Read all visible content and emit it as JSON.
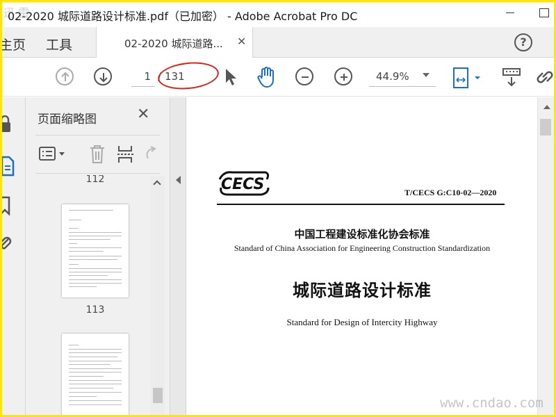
{
  "window": {
    "title": "02-2020 城际道路设计标准.pdf（已加密） - Adobe Acrobat Pro DC",
    "watermark_top": "迅 雷"
  },
  "tabs": {
    "home": "主页",
    "tools": "工具",
    "document": "02-2020 城际道路...",
    "help": "?"
  },
  "toolbar": {
    "page_current": "1",
    "page_separator": "/",
    "page_total": "131",
    "zoom": "44.9%"
  },
  "panel": {
    "title": "页面缩略图",
    "thumbnails": [
      "112",
      "113"
    ]
  },
  "document": {
    "logo_text": "CECS",
    "standard_code": "T/CECS G:C10-02—2020",
    "org_cn": "中国工程建设标准化协会标准",
    "org_en": "Standard of China Association for Engineering Construction Standardization",
    "title_cn": "城际道路设计标准",
    "title_en": "Standard for Design of Intercity Highway"
  },
  "footer": {
    "watermark": "www.cndao.com"
  },
  "colors": {
    "frame": "#ffe600",
    "annotation": "#e0211b",
    "active_tool": "#1a6ec8"
  }
}
